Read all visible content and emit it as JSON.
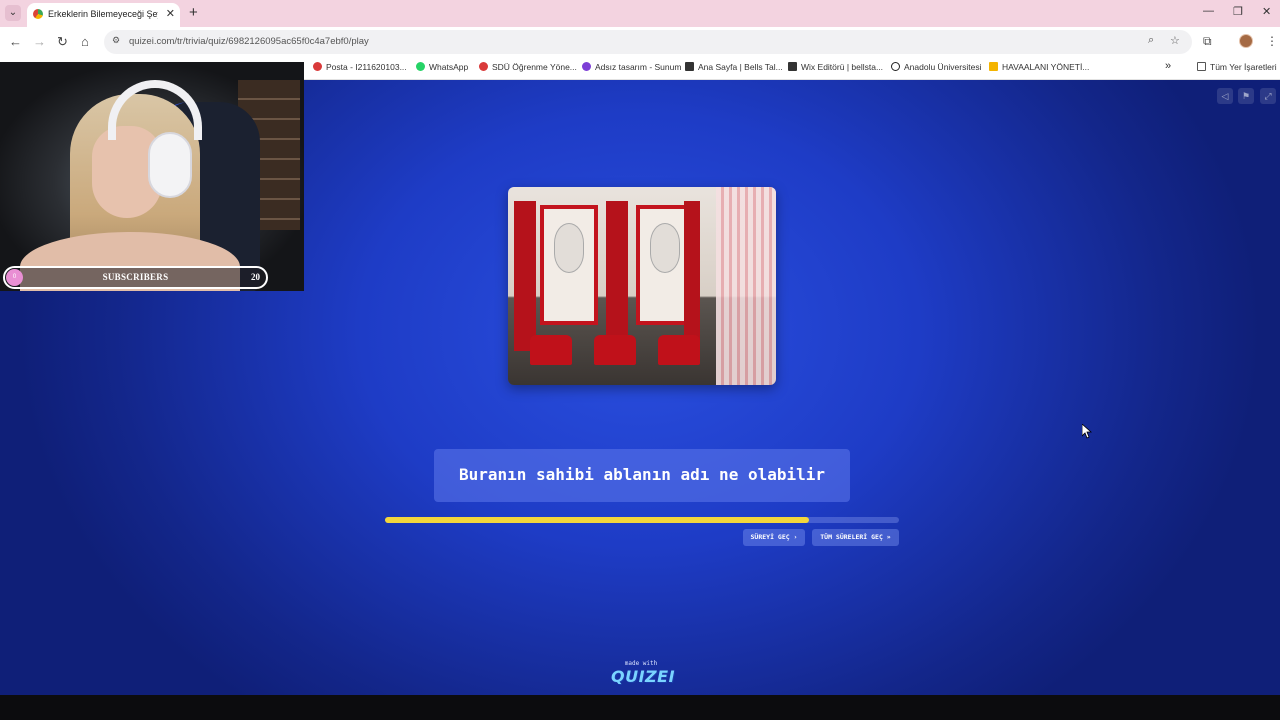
{
  "browser": {
    "tab_title": "Erkeklerin Bilemeyeceği Şeyler",
    "url": "quizei.com/tr/trivia/quiz/6982126095ac65f0c4a7ebf0/play",
    "bookmarks": [
      {
        "label": "Posta - I211620103...",
        "color": "#d93a3a"
      },
      {
        "label": "WhatsApp",
        "color": "#25d366"
      },
      {
        "label": "SDÜ Öğrenme Yöne...",
        "color": "#d93a3a"
      },
      {
        "label": "Adsız tasarım - Sunum",
        "color": "#7d3fd6"
      },
      {
        "label": "Ana Sayfa | Bells Tal...",
        "color": "#333333"
      },
      {
        "label": "Wix Editörü | bellsta...",
        "color": "#333333"
      },
      {
        "label": "Anadolu Üniversitesi",
        "color": "#222222"
      },
      {
        "label": "HAVAALANI YÖNETİ...",
        "color": "#f4b400"
      }
    ],
    "all_bookmarks_label": "Tüm Yer İşaretleri"
  },
  "quiz": {
    "question": "Buranın sahibi ablanın adı ne olabilir",
    "progress_fraction": 0.825,
    "skip_label": "SÜREYİ GEÇ ›",
    "skip_all_label": "TÜM SÜRELERİ GEÇ »",
    "made_with": "made with",
    "brand": "QUIZEI"
  },
  "overlay": {
    "subscribers_label": "SUBSCRIBERS",
    "subscribers_count": "20",
    "dot_label": "0"
  },
  "colors": {
    "accent_progress": "#f3d63c",
    "page_blue": "#1e3cc6"
  }
}
